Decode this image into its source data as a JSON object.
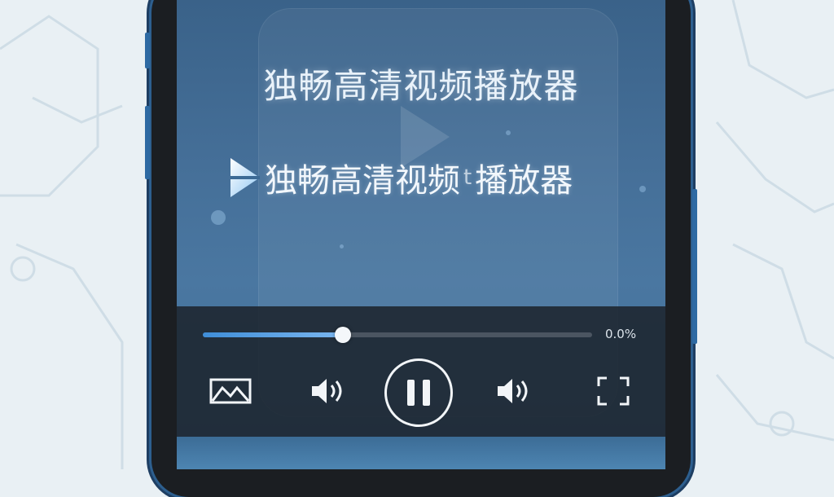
{
  "video": {
    "title": "独畅高清视频播放器",
    "subtitle": "独畅高清视频",
    "subtitle_glitch": "t",
    "subtitle_end": "播放器"
  },
  "player": {
    "progress_text": "0.0%",
    "progress_fraction": 0.36
  },
  "icons": {
    "gallery": "image-gallery-icon",
    "volume_down": "volume-down-icon",
    "pause": "pause-icon",
    "volume_up": "volume-up-icon",
    "fullscreen": "fullscreen-icon",
    "logo": "play-logo-icon"
  },
  "colors": {
    "screen_bg": "#456f98",
    "control_bar": "#1c242e",
    "progress": "#3f8ed8",
    "phone_frame": "#2e6aa3"
  }
}
